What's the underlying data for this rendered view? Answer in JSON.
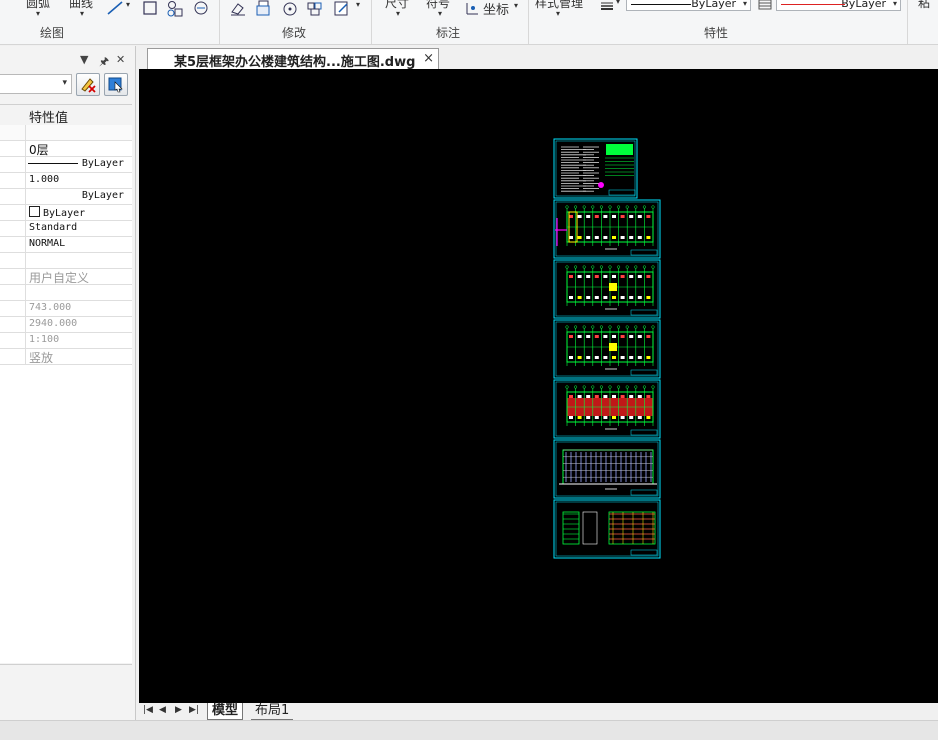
{
  "ribbon": {
    "draw_frags": [
      "圆弧",
      "曲线"
    ],
    "draw_group": "绘图",
    "modify_group": "修改",
    "annotate_frags": [
      "尺寸",
      "符号",
      "坐标"
    ],
    "annotate_group": "标注",
    "style_manager": "样式管理",
    "linetype_value": "ByLayer",
    "lineweight_value": "ByLayer",
    "properties_group": "特性",
    "right_frag": "粘"
  },
  "properties_panel": {
    "header_value": "特性值",
    "rows": [
      {
        "value": "",
        "section": true
      },
      {
        "value": "0层",
        "style": "cjk"
      },
      {
        "value": "ByLayer",
        "style": "linetype"
      },
      {
        "value": "1.000",
        "style": "mono"
      },
      {
        "value": "ByLayer",
        "style": "right"
      },
      {
        "value": "ByLayer",
        "style": "color"
      },
      {
        "value": "Standard",
        "style": "mono"
      },
      {
        "value": "NORMAL",
        "style": "mono"
      },
      {
        "value": "",
        "style": "empty"
      },
      {
        "value": "用户自定义",
        "style": "cjk-gray"
      },
      {
        "value": "",
        "style": "empty"
      },
      {
        "value": "743.000",
        "style": "gray"
      },
      {
        "value": "2940.000",
        "style": "gray"
      },
      {
        "value": "1:100",
        "style": "gray"
      },
      {
        "value": "竖放",
        "style": "cjk-gray"
      }
    ]
  },
  "document": {
    "tab_title": "某5层框架办公楼建筑结构...施工图.dwg",
    "close_symbol": "×"
  },
  "layout_tabs": {
    "nav": [
      "|◀",
      "◀",
      "▶",
      "▶|"
    ],
    "tabs": [
      "模型",
      "布局1"
    ],
    "active": "模型"
  },
  "colors": {
    "canvas_bg": "#000000",
    "frame": "#00e5ff",
    "plan_lines": "#00ff3c",
    "wall_fill": "#c01818",
    "accent_magenta": "#ff00ff",
    "accent_yellow": "#ffff00",
    "panel_bg": "#f3f3f3"
  },
  "icons": [
    "line-icon",
    "rectangle-icon",
    "shapes-icon",
    "region-icon",
    "erase-icon",
    "copy-icon",
    "rotate-icon",
    "array-icon",
    "edit-icon",
    "coordinate-icon",
    "lineweight-icon",
    "pin-icon",
    "close-panel-icon",
    "dropdown-arrow-icon",
    "clear-selection-icon",
    "quick-select-icon"
  ]
}
